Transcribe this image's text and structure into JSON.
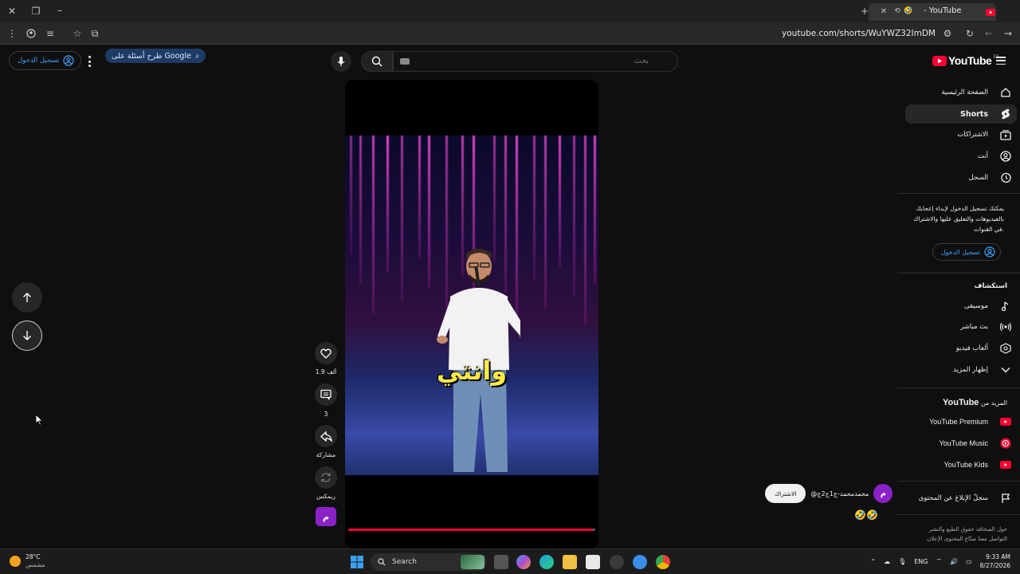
{
  "browser": {
    "tab_title": "- YouTube",
    "url": "youtube.com/shorts/WuYWZ32ImDM",
    "gemini_chip": "طرح أسئلة على Google"
  },
  "header": {
    "search_placeholder": "بحث",
    "signin_label": "تسجيل الدخول",
    "logo_text": "YouTube",
    "logo_region": "ES"
  },
  "sidebar": {
    "items": [
      {
        "label": "الصفحة الرئيسية",
        "icon": "home-icon"
      },
      {
        "label": "Shorts",
        "icon": "shorts-icon"
      },
      {
        "label": "الاشتراكات",
        "icon": "subscriptions-icon"
      },
      {
        "label": "أنت",
        "icon": "you-icon"
      },
      {
        "label": "السجل",
        "icon": "history-icon"
      }
    ],
    "signin_prompt": "يمكنك تسجيل الدخول لإبداء إعجابك بالفيديوهات والتعليق عليها والاشتراك في القنوات.",
    "signin_label": "تسجيل الدخول",
    "explore_heading": "استكشاف",
    "explore_items": [
      {
        "label": "موسيقى",
        "icon": "music-icon"
      },
      {
        "label": "بث مباشر",
        "icon": "live-icon"
      },
      {
        "label": "ألعاب فيديو",
        "icon": "gaming-icon"
      },
      {
        "label": "إظهار المزيد",
        "icon": "chevron-down-icon"
      }
    ],
    "more_heading_prefix": "المزيد من",
    "more_heading_brand": "YouTube",
    "more_items": [
      {
        "label": "YouTube Premium"
      },
      {
        "label": "YouTube Music"
      },
      {
        "label": "YouTube Kids"
      }
    ],
    "report_history": "سجلّ الإبلاغ عن المحتوى",
    "footer_line1": "حول  الصحافة  حقوق الطبع والنشر",
    "footer_line2": "التواصل معنا  صنّاع المحتوى  الإعلان"
  },
  "short": {
    "caption": "وانتي",
    "progress": 0.99,
    "likes": "1.9 ألف",
    "comments": "3",
    "share_label": "مشاركة",
    "remix_label": "ريمكس",
    "channel_initial": "م",
    "channel_name": "@محمدمحمد-ج1ج2ج",
    "subscribe_label": "الاشتراك",
    "title": "🤣🤣"
  },
  "taskbar": {
    "temperature": "28°C",
    "weather": "مشمس",
    "search_label": "Search",
    "language": "ENG",
    "time": "9:33 AM",
    "date": "8/27/2026"
  }
}
